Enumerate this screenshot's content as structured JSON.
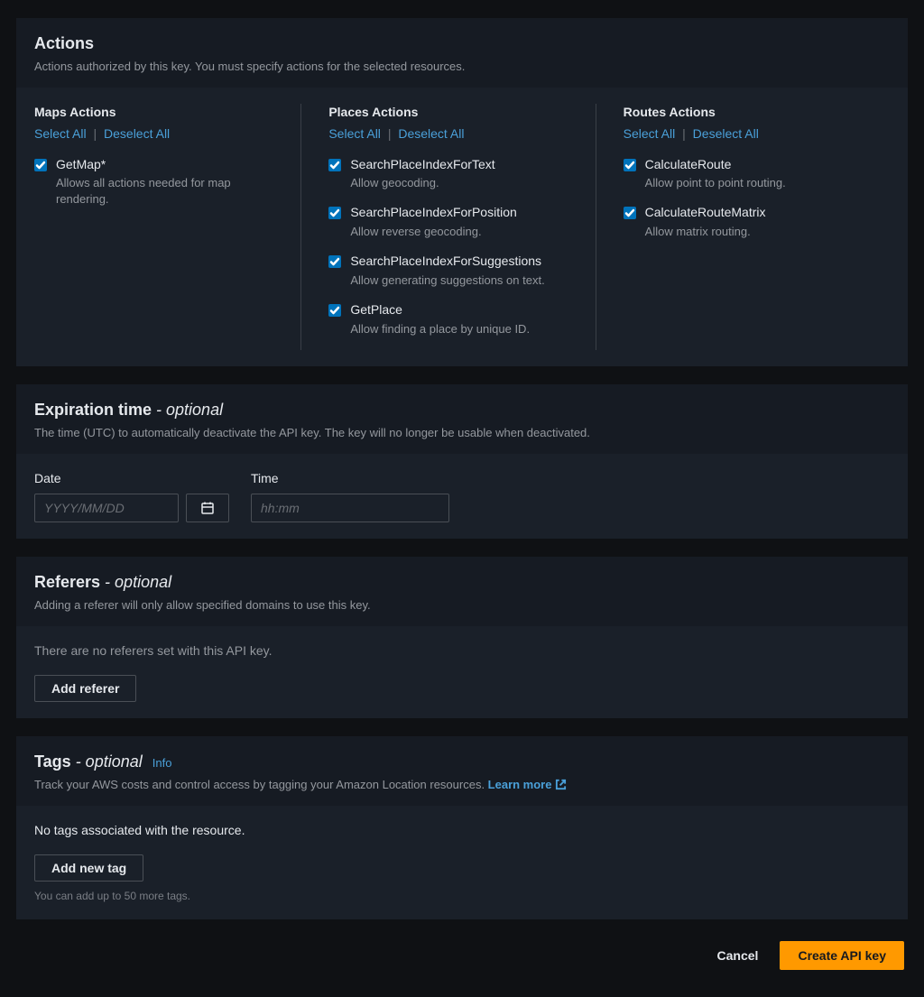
{
  "actions": {
    "title": "Actions",
    "subtitle": "Actions authorized by this key. You must specify actions for the selected resources.",
    "select_all": "Select All",
    "deselect_all": "Deselect All",
    "separator": "|",
    "columns": {
      "maps": {
        "title": "Maps Actions",
        "items": [
          {
            "label": "GetMap*",
            "desc": "Allows all actions needed for map rendering.",
            "checked": true
          }
        ]
      },
      "places": {
        "title": "Places Actions",
        "items": [
          {
            "label": "SearchPlaceIndexForText",
            "desc": "Allow geocoding.",
            "checked": true
          },
          {
            "label": "SearchPlaceIndexForPosition",
            "desc": "Allow reverse geocoding.",
            "checked": true
          },
          {
            "label": "SearchPlaceIndexForSuggestions",
            "desc": "Allow generating suggestions on text.",
            "checked": true
          },
          {
            "label": "GetPlace",
            "desc": "Allow finding a place by unique ID.",
            "checked": true
          }
        ]
      },
      "routes": {
        "title": "Routes Actions",
        "items": [
          {
            "label": "CalculateRoute",
            "desc": "Allow point to point routing.",
            "checked": true
          },
          {
            "label": "CalculateRouteMatrix",
            "desc": "Allow matrix routing.",
            "checked": true
          }
        ]
      }
    }
  },
  "expiration": {
    "title": "Expiration time",
    "optional": " - optional",
    "subtitle": "The time (UTC) to automatically deactivate the API key. The key will no longer be usable when deactivated.",
    "date_label": "Date",
    "date_placeholder": "YYYY/MM/DD",
    "time_label": "Time",
    "time_placeholder": "hh:mm"
  },
  "referers": {
    "title": "Referers",
    "optional": " - optional",
    "subtitle": "Adding a referer will only allow specified domains to use this key.",
    "empty": "There are no referers set with this API key.",
    "add_btn": "Add referer"
  },
  "tags": {
    "title": "Tags",
    "optional": " - optional",
    "info": "Info",
    "subtitle_prefix": "Track your AWS costs and control access by tagging your Amazon Location resources. ",
    "learn_more": "Learn more",
    "empty": "No tags associated with the resource.",
    "add_btn": "Add new tag",
    "hint": "You can add up to 50 more tags."
  },
  "footer": {
    "cancel": "Cancel",
    "create": "Create API key"
  }
}
